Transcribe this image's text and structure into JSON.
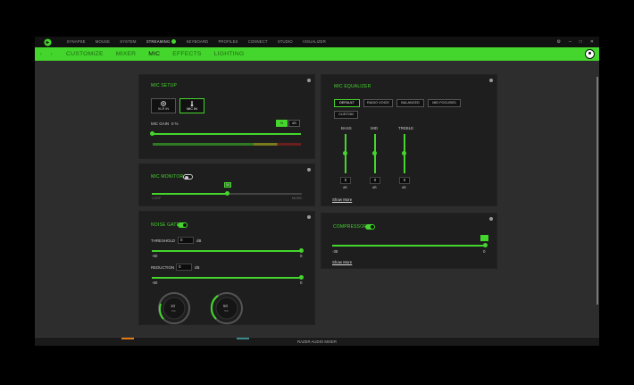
{
  "topnav": {
    "items": [
      "SYNAPSE",
      "MOUSE",
      "SYSTEM",
      "STREAMING",
      "KEYBOARD",
      "PROFILES",
      "CONNECT",
      "STUDIO",
      "VISUALIZER"
    ],
    "active": "STREAMING"
  },
  "window_controls": {
    "settings": "⚙",
    "minimize": "–",
    "maximize": "□",
    "close": "✕"
  },
  "subnav": {
    "back": "‹",
    "forward": "›",
    "tabs": [
      "CUSTOMIZE",
      "MIXER",
      "MIC",
      "EFFECTS",
      "LIGHTING"
    ],
    "active": "MIC"
  },
  "mic_setup": {
    "title": "MIC SETUP",
    "devices": [
      "XLR IN",
      "MIC IN"
    ],
    "selected": "MIC IN",
    "gain_label": "MIC GAIN",
    "gain_value": "0 %",
    "unit_percent": "%",
    "unit_db": "dB",
    "gain_level": 0
  },
  "mic_monitor": {
    "title": "MIC MONITOR",
    "enabled": false,
    "value": "50",
    "left_label": "LOOP",
    "right_label": "MUSIC",
    "level": 0.5
  },
  "noise_gate": {
    "title": "NOISE GATE",
    "enabled": true,
    "threshold_label": "THRESHOLD",
    "threshold_value": "0",
    "threshold_unit": "dB",
    "threshold_min": "-60",
    "threshold_max": "0",
    "threshold_level": 1,
    "reduction_label": "REDUCTION",
    "reduction_value": "0",
    "reduction_unit": "dB",
    "reduction_min": "-60",
    "reduction_max": "0",
    "reduction_level": 1,
    "dial1_value": "10",
    "dial1_unit": "ms",
    "dial2_value": "50",
    "dial2_unit": "ms"
  },
  "mic_equalizer": {
    "title": "MIC EQUALIZER",
    "presets": [
      "DEFAULT",
      "RADIO VOICE",
      "BALANCED",
      "MID FOCUSED",
      "CUSTOM"
    ],
    "selected": "DEFAULT",
    "bands": [
      {
        "label": "BASS",
        "value": "0",
        "unit": "dB"
      },
      {
        "label": "MID",
        "value": "0",
        "unit": "dB"
      },
      {
        "label": "TREBLE",
        "value": "0",
        "unit": "dB"
      }
    ],
    "show_more": "Show More"
  },
  "compressor": {
    "title": "COMPRESSOR",
    "enabled": true,
    "min": "-38",
    "max": "0",
    "marker_value": "0",
    "level": 1,
    "show_more": "Show More"
  },
  "statusbar": {
    "text": "RAZER AUDIO MIXER"
  },
  "colors": {
    "accent": "#44d62c",
    "panel": "#1e1e1e",
    "background": "#2d2d2d"
  }
}
